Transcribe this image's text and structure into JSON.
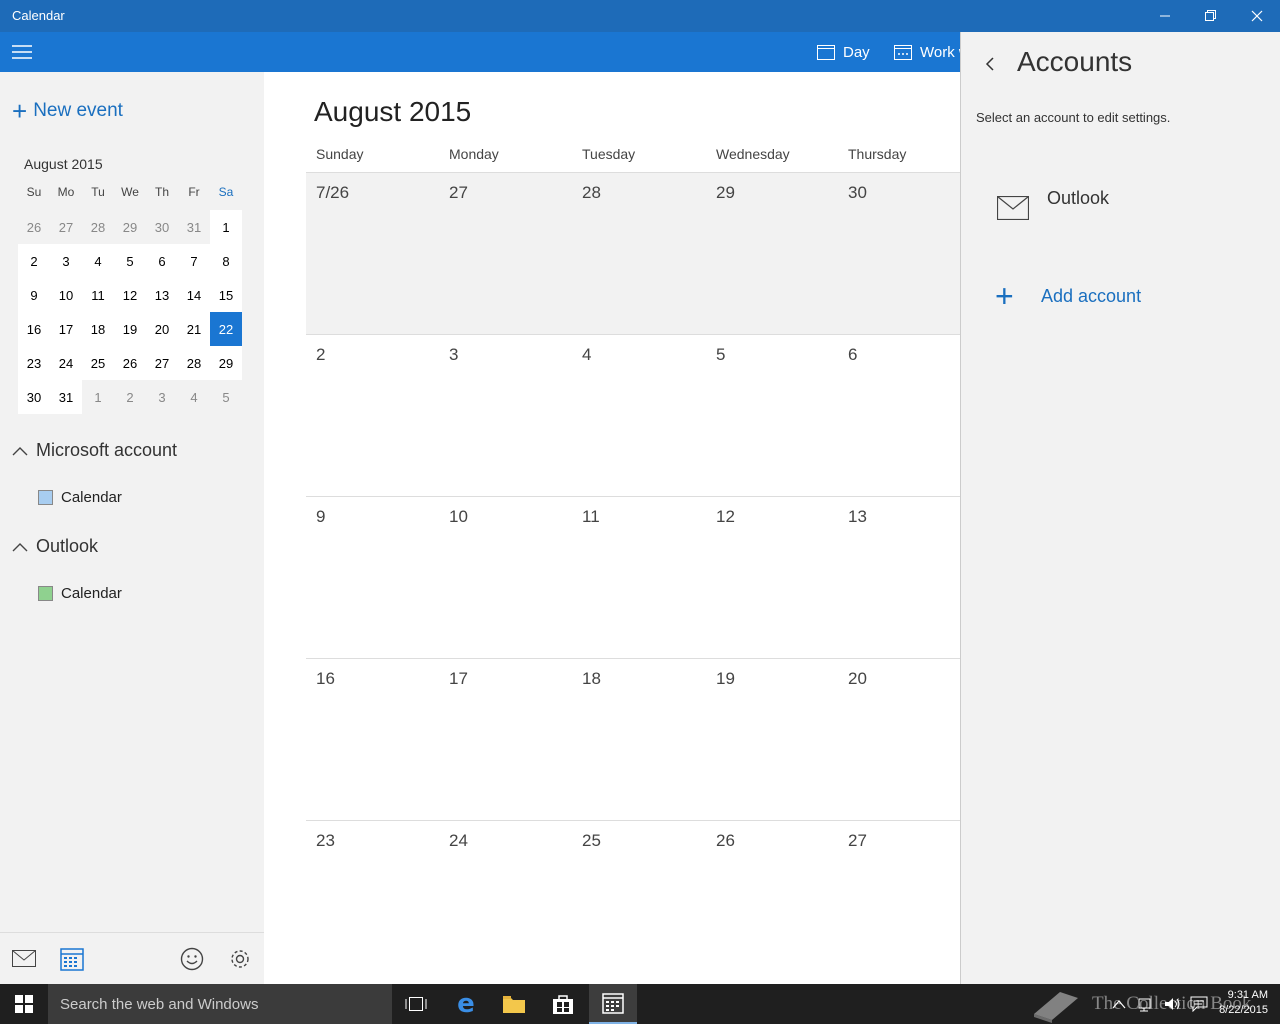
{
  "window": {
    "title": "Calendar",
    "controls": [
      "minimize-icon",
      "restore-icon",
      "close-icon"
    ]
  },
  "commandbar": {
    "views": [
      {
        "label": "Day",
        "icon": "calendar-day-icon"
      },
      {
        "label": "Work week",
        "icon": "calendar-week-icon"
      }
    ]
  },
  "leftpane": {
    "new_event": "New event",
    "mini_calendar": {
      "title": "August 2015",
      "weekdays": [
        "Su",
        "Mo",
        "Tu",
        "We",
        "Th",
        "Fr",
        "Sa"
      ],
      "weeks": [
        [
          "26",
          "27",
          "28",
          "29",
          "30",
          "31",
          "1"
        ],
        [
          "2",
          "3",
          "4",
          "5",
          "6",
          "7",
          "8"
        ],
        [
          "9",
          "10",
          "11",
          "12",
          "13",
          "14",
          "15"
        ],
        [
          "16",
          "17",
          "18",
          "19",
          "20",
          "21",
          "22"
        ],
        [
          "23",
          "24",
          "25",
          "26",
          "27",
          "28",
          "29"
        ],
        [
          "30",
          "31",
          "1",
          "2",
          "3",
          "4",
          "5"
        ]
      ],
      "selected": "22"
    },
    "groups": [
      {
        "name": "Microsoft account",
        "calendars": [
          {
            "name": "Calendar",
            "color": "#a8cdf0"
          }
        ]
      },
      {
        "name": "Outlook",
        "calendars": [
          {
            "name": "Calendar",
            "color": "#8fd18f"
          }
        ]
      }
    ],
    "bottom_icons": [
      "mail-icon",
      "calendar-icon",
      "feedback-smiley-icon",
      "settings-gear-icon"
    ]
  },
  "main": {
    "month_title": "August 2015",
    "weekdays": [
      "Sunday",
      "Monday",
      "Tuesday",
      "Wednesday",
      "Thursday"
    ],
    "weeks": [
      [
        "7/26",
        "27",
        "28",
        "29",
        "30"
      ],
      [
        "2",
        "3",
        "4",
        "5",
        "6"
      ],
      [
        "9",
        "10",
        "11",
        "12",
        "13"
      ],
      [
        "16",
        "17",
        "18",
        "19",
        "20"
      ],
      [
        "23",
        "24",
        "25",
        "26",
        "27"
      ]
    ]
  },
  "accounts": {
    "title": "Accounts",
    "subtitle": "Select an account to edit settings.",
    "items": [
      {
        "name": "Outlook",
        "icon": "mail-envelope-icon"
      }
    ],
    "add_label": "Add account"
  },
  "taskbar": {
    "search_placeholder": "Search the web and Windows",
    "time": "9:31 AM",
    "date": "8/22/2015",
    "watermark": "The Collection Book"
  }
}
